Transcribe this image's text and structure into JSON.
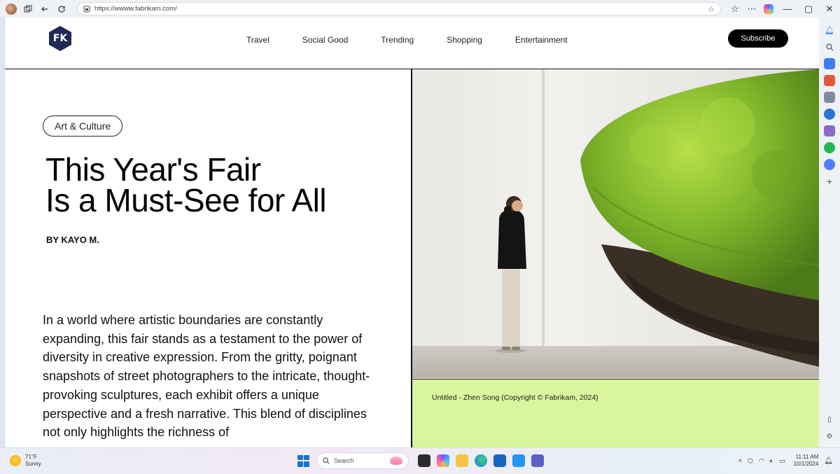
{
  "browser": {
    "url": "https://wwww.fabrikam.com/"
  },
  "site": {
    "logo_text": "FK",
    "nav": [
      "Travel",
      "Social Good",
      "Trending",
      "Shopping",
      "Entertainment"
    ],
    "subscribe_label": "Subscribe"
  },
  "article": {
    "tag": "Art & Culture",
    "headline_line1": "This Year's Fair",
    "headline_line2": "Is a Must-See for All",
    "byline": "BY KAYO M.",
    "body": "In a world where artistic boundaries are constantly expanding, this fair stands as a testament to the power of diversity in creative expression. From the gritty, poignant snapshots of street photographers to the intricate, thought-provoking sculptures, each exhibit offers a unique perspective and a fresh narrative. This blend of disciplines not only highlights the richness of",
    "caption": "Untitled - Zhen Song  (Copyright © Fabrikam, 2024)",
    "caption_bg": "#d9f59e"
  },
  "taskbar": {
    "temperature": "71°F",
    "condition": "Sunny",
    "search_placeholder": "Search",
    "time": "11:11 AM",
    "date": "10/1/2024"
  },
  "icons": {
    "browser_left": [
      "profile-avatar-icon",
      "tab-actions-icon",
      "back-arrow-icon",
      "refresh-icon"
    ],
    "browser_right": [
      "favorites-icon",
      "more-icon",
      "copilot-icon",
      "minimize-icon",
      "maximize-icon",
      "close-icon"
    ],
    "sidebar": [
      "notification-bell-icon",
      "search-icon",
      "shopping-tag-icon",
      "toolbox-icon",
      "games-icon",
      "office-icon",
      "chess-icon",
      "spotify-icon",
      "messenger-icon",
      "add-icon"
    ]
  }
}
